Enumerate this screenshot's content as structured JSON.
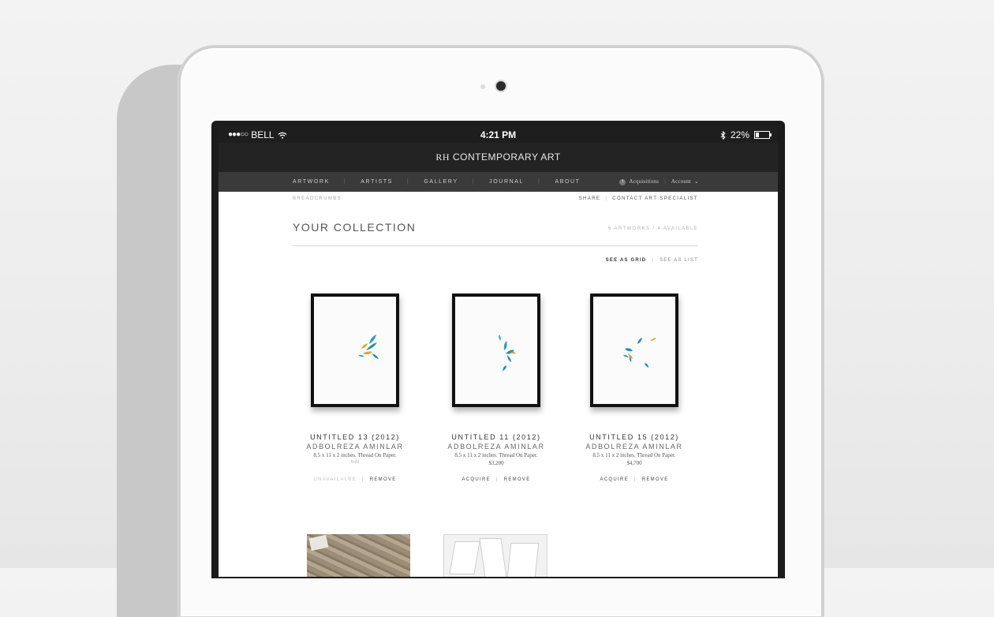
{
  "status_bar": {
    "signal_dots": "●●●○○",
    "carrier": "BELL",
    "time": "4:21 PM",
    "battery_percent": "22%",
    "battery_level": 0.22
  },
  "brand": {
    "mark": "RH",
    "name": "CONTEMPORARY ART"
  },
  "nav": {
    "items": [
      "ARTWORK",
      "ARTISTS",
      "GALLERY",
      "JOURNAL",
      "ABOUT"
    ],
    "acquisitions_count": "1",
    "acquisitions_label": "Acquisitions",
    "account_label": "Account",
    "account_chevron": "⌄"
  },
  "breadcrumbs": "BREADCRUMBS",
  "share_label": "SHARE",
  "contact_label": "CONTACT ART SPECIALIST",
  "page_title": "YOUR COLLECTION",
  "collection_count": "6 ARTWORKS / 4 AVAILABLE",
  "view_grid_label": "SEE AS GRID",
  "view_list_label": "SEE AS LIST",
  "artworks": [
    {
      "title": "UNTITLED 13 (2012)",
      "artist": "ADBOLREZA AMINLAR",
      "detail": "8.5 x 11 x 2 inches. Thread On Paper.",
      "status": "Sold",
      "primary_action": "UNAVAILALBE",
      "secondary_action": "REMOVE"
    },
    {
      "title": "UNTITLED 11 (2012)",
      "artist": "ADBOLREZA AMINLAR",
      "detail": "8.5 x 11 x 2 inches. Thread On Paper.",
      "price": "$3,200",
      "primary_action": "ACQUIRE",
      "secondary_action": "REMOVE"
    },
    {
      "title": "UNTITLED 15 (2012)",
      "artist": "ADBOLREZA AMINLAR",
      "detail": "8.5 x 11 x 2 inches. Thread On Paper.",
      "price": "$4,700",
      "primary_action": "ACQUIRE",
      "secondary_action": "REMOVE"
    }
  ],
  "colors": {
    "teal": "#1f8fb0",
    "amber": "#e2a227"
  }
}
